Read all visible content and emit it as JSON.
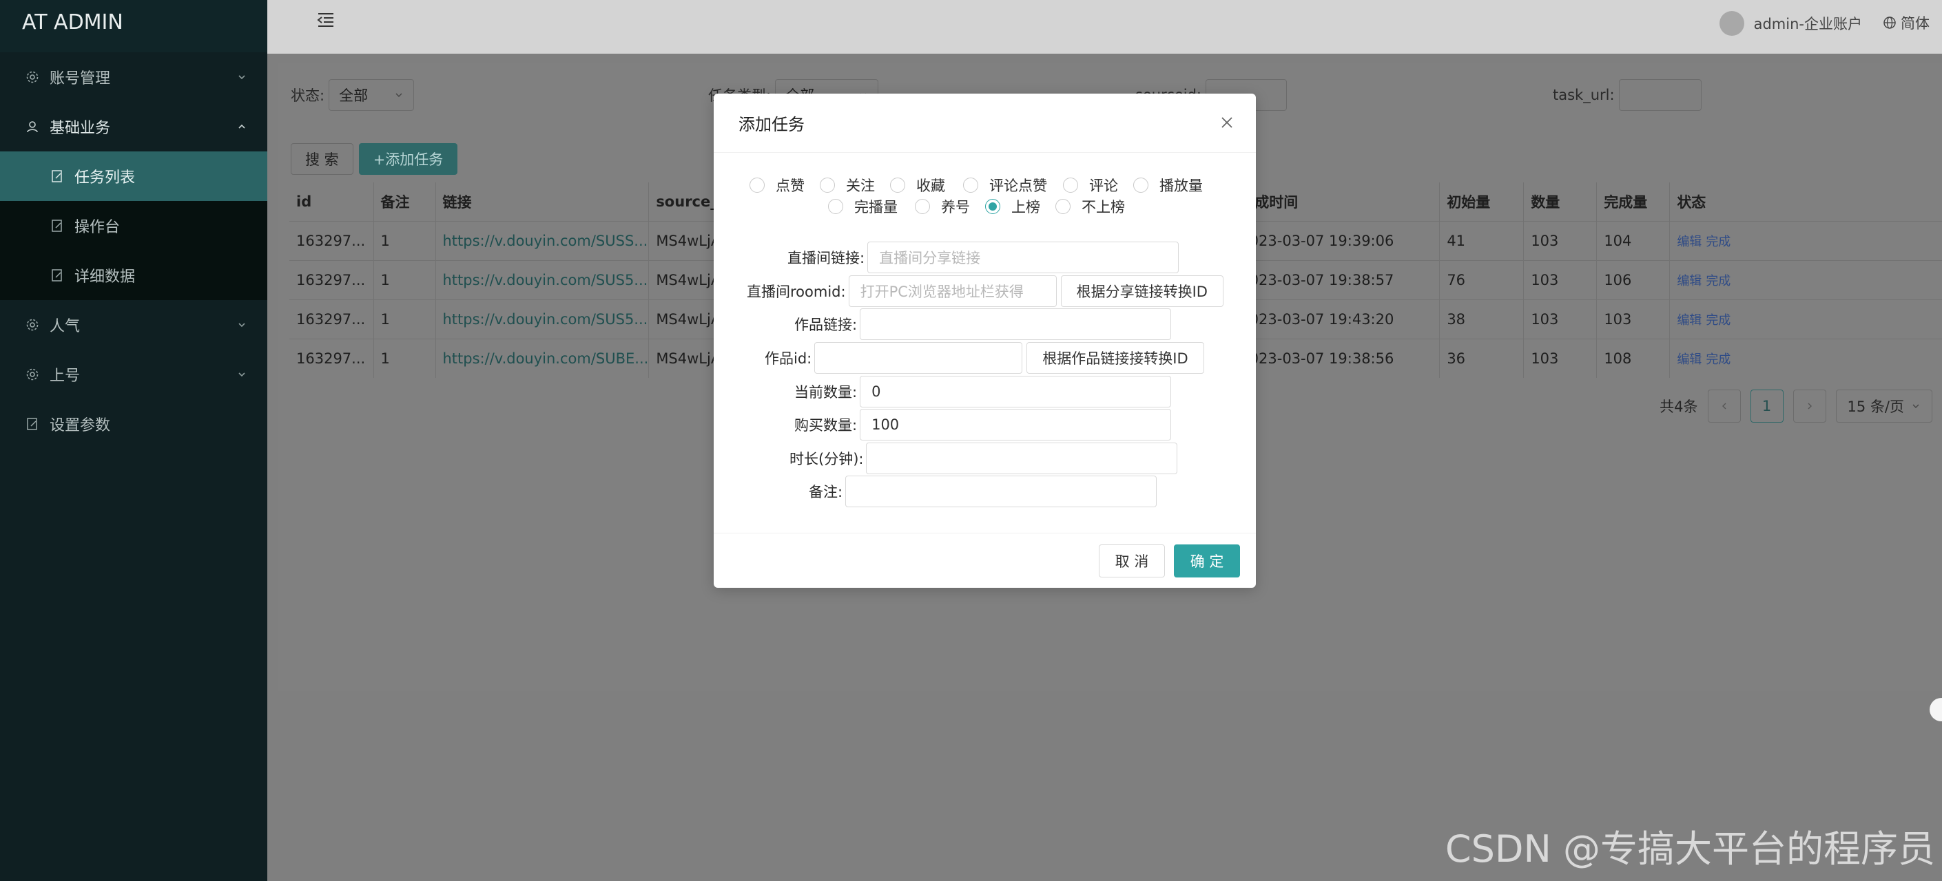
{
  "app": {
    "title": "AT ADMIN"
  },
  "sidebar": {
    "items": [
      {
        "label": "账号管理",
        "icon": "gear-icon"
      },
      {
        "label": "基础业务",
        "icon": "user-icon"
      },
      {
        "label": "任务列表",
        "icon": "edit-icon"
      },
      {
        "label": "操作台",
        "icon": "edit-icon"
      },
      {
        "label": "详细数据",
        "icon": "edit-icon"
      },
      {
        "label": "人气",
        "icon": "gear-icon"
      },
      {
        "label": "上号",
        "icon": "gear-icon"
      },
      {
        "label": "设置参数",
        "icon": "edit-icon"
      }
    ]
  },
  "header": {
    "user": "admin-企业账户",
    "lang": "简体"
  },
  "filters": {
    "status_label": "状态:",
    "status_value": "全部",
    "task_type_label": "任务类型:",
    "task_type_value": "全部",
    "sourceid_label": "sourceid:",
    "task_url_label": "task_url:"
  },
  "toolbar": {
    "search": "搜 索",
    "add_task": "+添加任务"
  },
  "table": {
    "headers": [
      "id",
      "备注",
      "链接",
      "source_id",
      "完成时间",
      "初始量",
      "数量",
      "完成量",
      "状态"
    ],
    "rows": [
      {
        "id": "163297...",
        "note": "1",
        "link": "https://v.douyin.com/SUSS...",
        "source": "MS4wLjA",
        "time": "2023-03-07 19:39:06",
        "init": "41",
        "qty": "103",
        "done": "104"
      },
      {
        "id": "163297...",
        "note": "1",
        "link": "https://v.douyin.com/SUS5...",
        "source": "MS4wLjA",
        "time": "2023-03-07 19:38:57",
        "init": "76",
        "qty": "103",
        "done": "106"
      },
      {
        "id": "163297...",
        "note": "1",
        "link": "https://v.douyin.com/SUS5...",
        "source": "MS4wLjA",
        "time": "2023-03-07 19:43:20",
        "init": "38",
        "qty": "103",
        "done": "103"
      },
      {
        "id": "163297...",
        "note": "1",
        "link": "https://v.douyin.com/SUBE...",
        "source": "MS4wLjA",
        "time": "2023-03-07 19:38:56",
        "init": "36",
        "qty": "103",
        "done": "108"
      }
    ],
    "edit_label": "编辑",
    "complete_label": "完成"
  },
  "pager": {
    "total": "共4条",
    "current": "1",
    "size": "15 条/页"
  },
  "modal": {
    "title": "添加任务",
    "radios": [
      "点赞",
      "关注",
      "收藏",
      "评论点赞",
      "评论",
      "播放量",
      "完播量",
      "养号",
      "上榜",
      "不上榜"
    ],
    "selected_radio": "上榜",
    "fields": {
      "live_link_label": "直播间链接:",
      "live_link_placeholder": "直播间分享链接",
      "roomid_label": "直播间roomid:",
      "roomid_placeholder": "打开PC浏览器地址栏获得",
      "roomid_btn": "根据分享链接转换ID",
      "work_link_label": "作品链接:",
      "work_id_label": "作品id:",
      "work_id_btn": "根据作品链接接转换ID",
      "current_qty_label": "当前数量:",
      "current_qty_value": "0",
      "buy_qty_label": "购买数量:",
      "buy_qty_value": "100",
      "duration_label": "时长(分钟):",
      "note_label": "备注:"
    },
    "cancel": "取 消",
    "ok": "确 定"
  },
  "watermark": "CSDN @专搞大平台的程序员"
}
